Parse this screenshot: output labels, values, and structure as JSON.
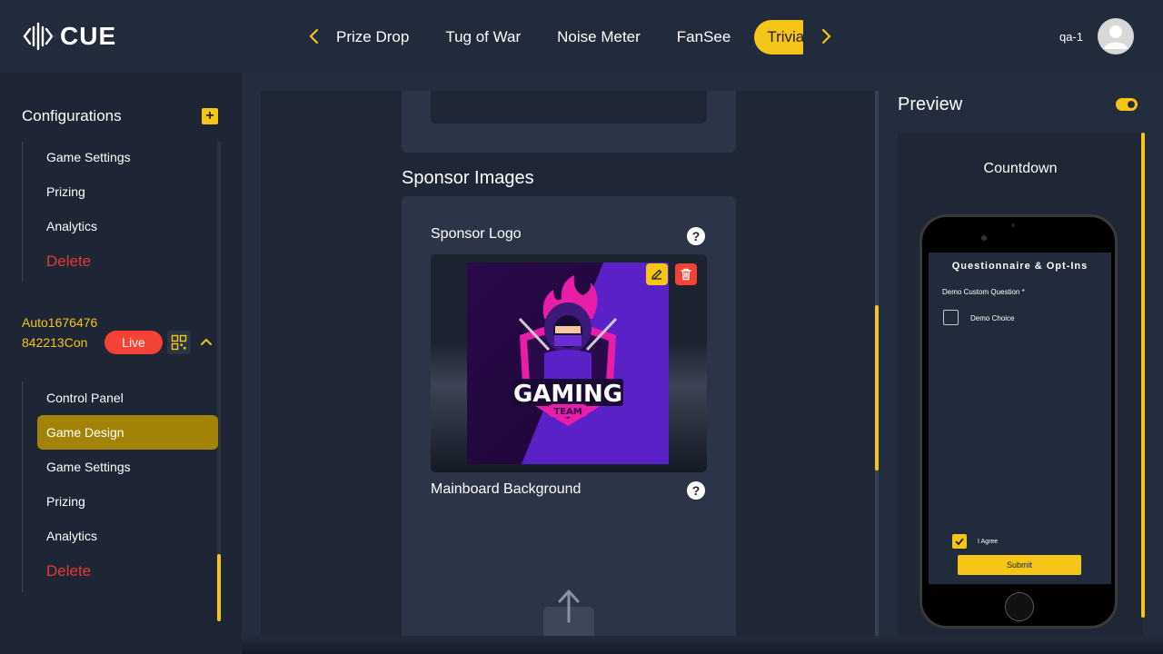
{
  "header": {
    "logo_text": "CUE",
    "tabs": [
      "Prize Drop",
      "Tug of War",
      "Noise Meter",
      "FanSee",
      "Trivia"
    ],
    "active_tab": "Trivia",
    "username": "qa-1"
  },
  "sidebar": {
    "title": "Configurations",
    "group1": {
      "items": [
        "Game Settings",
        "Prizing",
        "Analytics"
      ],
      "delete_label": "Delete"
    },
    "game": {
      "name": "Auto1676476842213Con",
      "status": "Live"
    },
    "group2": {
      "items": [
        "Control Panel",
        "Game Design",
        "Game Settings",
        "Prizing",
        "Analytics"
      ],
      "active_item": "Game Design",
      "delete_label": "Delete"
    }
  },
  "editor": {
    "section_title": "Sponsor Images",
    "sponsor_logo_label": "Sponsor Logo",
    "mainboard_label": "Mainboard Background",
    "logo_image_text": "GAMING",
    "logo_image_subtext": "TEAM"
  },
  "preview": {
    "title": "Preview",
    "toggle_on": true,
    "screen_label": "Countdown",
    "phone": {
      "title": "Questionnaire & Opt-Ins",
      "question": "Demo Custom Question *",
      "choice": "Demo Choice",
      "agree": "I Agree",
      "submit": "Submit"
    }
  },
  "colors": {
    "accent": "#f5c518",
    "danger": "#f44336",
    "background": "#1e2636"
  }
}
